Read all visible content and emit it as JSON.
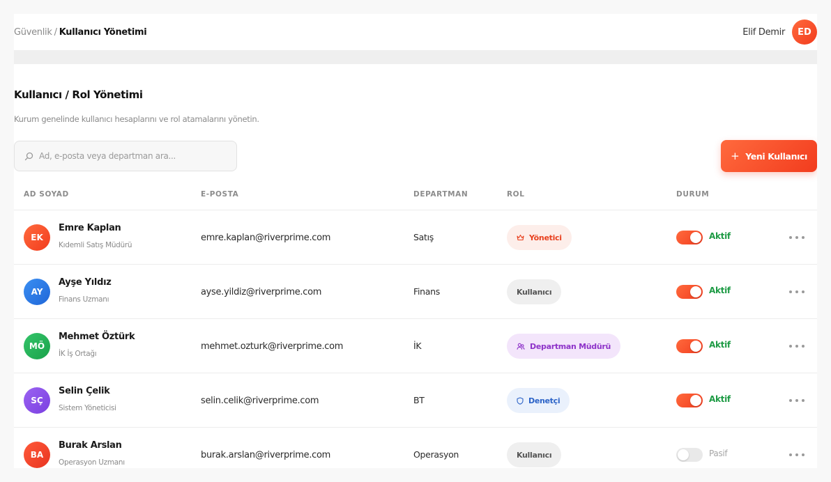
{
  "breadcrumb": {
    "parent": "Güvenlik",
    "separator": "/",
    "current": "Kullanıcı Yönetimi"
  },
  "user": {
    "name": "Elif Demir",
    "initials": "ED"
  },
  "page": {
    "title": "Kullanıcı / Rol Yönetimi",
    "description": "Kurum genelinde kullanıcı hesaplarını ve rol atamalarını yönetin."
  },
  "search": {
    "placeholder": "Ad, e-posta veya departman ara...",
    "value": "",
    "icon": "search-icon"
  },
  "new_user_button": {
    "icon": "+",
    "label": "Yeni Kullanıcı"
  },
  "table": {
    "headers": {
      "name": "AD SOYAD",
      "email": "E-POSTA",
      "department": "DEPARTMAN",
      "role": "ROL",
      "status": "DURUM"
    },
    "rows": [
      {
        "initials": "EK",
        "avatar_color": "#f2461f",
        "name": "Emre Kaplan",
        "title": "Kıdemli Satış Müdürü",
        "email": "emre.kaplan@riverprime.com",
        "department": "Satış",
        "role": "Yönetici",
        "role_icon": "crown-icon",
        "status": "Aktif",
        "active": true
      },
      {
        "initials": "AY",
        "avatar_color": "#2a7de8",
        "name": "Ayşe Yıldız",
        "title": "Finans Uzmanı",
        "email": "ayse.yildiz@riverprime.com",
        "department": "Finans",
        "role": "Kullanıcı",
        "role_icon": "",
        "status": "Aktif",
        "active": true
      },
      {
        "initials": "MÖ",
        "avatar_color": "#22b558",
        "name": "Mehmet Öztürk",
        "title": "İK İş Ortağı",
        "email": "mehmet.ozturk@riverprime.com",
        "department": "İK",
        "role": "Departman Müdürü",
        "role_icon": "users-icon",
        "status": "Aktif",
        "active": true
      },
      {
        "initials": "SÇ",
        "avatar_color": "#8a4fe8",
        "name": "Selin Çelik",
        "title": "Sistem Yöneticisi",
        "email": "selin.celik@riverprime.com",
        "department": "BT",
        "role": "Denetçi",
        "role_icon": "shield-icon",
        "status": "Aktif",
        "active": true
      },
      {
        "initials": "BA",
        "avatar_color": "#ef3d26",
        "name": "Burak Arslan",
        "title": "Operasyon Uzmanı",
        "email": "burak.arslan@riverprime.com",
        "department": "Operasyon",
        "role": "Kullanıcı",
        "role_icon": "",
        "status": "Pasif",
        "active": false
      }
    ]
  }
}
